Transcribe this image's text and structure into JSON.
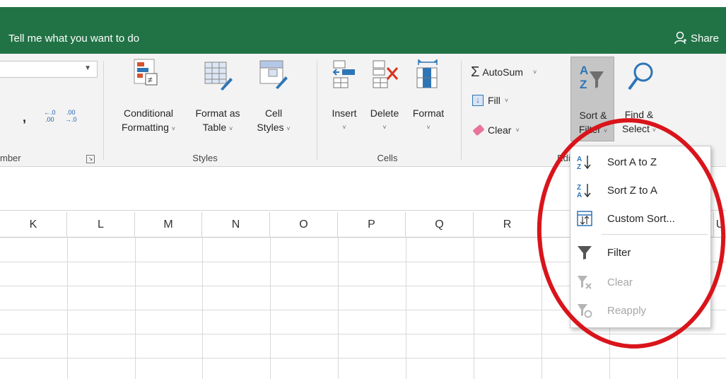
{
  "titlebar": {
    "tell_me": "Tell me what you want to do",
    "share": "Share"
  },
  "ribbon": {
    "number": {
      "label": "mber",
      "comma": ",",
      "inc_decimal": "←.0\n.00",
      "dec_decimal": ".00\n→.0"
    },
    "styles": {
      "label": "Styles",
      "conditional_1": "Conditional",
      "conditional_2": "Formatting",
      "format_table_1": "Format as",
      "format_table_2": "Table",
      "cell_styles_1": "Cell",
      "cell_styles_2": "Styles"
    },
    "cells": {
      "label": "Cells",
      "insert": "Insert",
      "delete": "Delete",
      "format": "Format"
    },
    "editing": {
      "label": "Edi",
      "autosum": "AutoSum",
      "fill": "Fill",
      "clear": "Clear",
      "sort_filter_1": "Sort &",
      "sort_filter_2": "Filter",
      "find_select_1": "Find &",
      "find_select_2": "Select"
    }
  },
  "columns": [
    "K",
    "L",
    "M",
    "N",
    "O",
    "P",
    "Q",
    "R",
    "U"
  ],
  "dropdown": {
    "items": [
      {
        "label": "Sort A to Z",
        "icon": "sort-az-icon",
        "enabled": true
      },
      {
        "label": "Sort Z to A",
        "icon": "sort-za-icon",
        "enabled": true
      },
      {
        "label": "Custom Sort...",
        "icon": "custom-sort-icon",
        "enabled": true
      },
      {
        "label": "Filter",
        "icon": "filter-icon",
        "enabled": true
      },
      {
        "label": "Clear",
        "icon": "clear-filter-icon",
        "enabled": false
      },
      {
        "label": "Reapply",
        "icon": "reapply-filter-icon",
        "enabled": false
      }
    ]
  },
  "colors": {
    "title_green": "#217346",
    "annotation_red": "#d9141b"
  }
}
